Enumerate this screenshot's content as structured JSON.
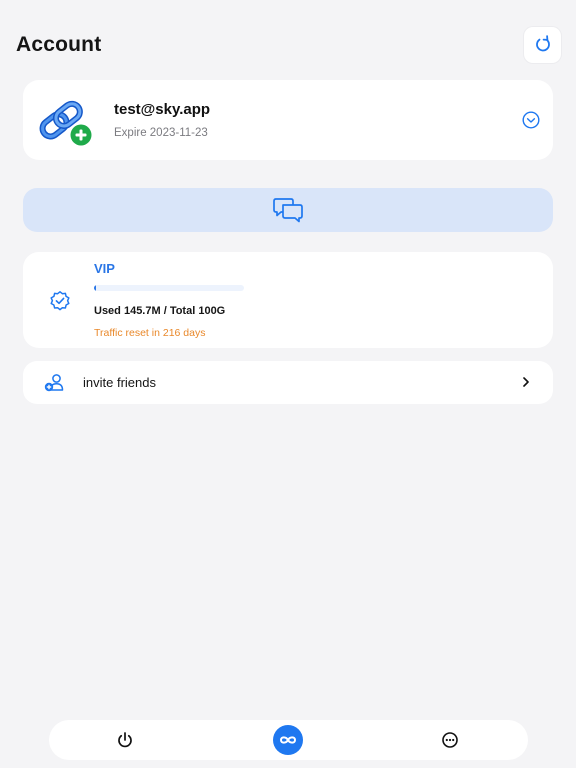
{
  "header": {
    "title": "Account",
    "refresh_icon": "refresh-icon"
  },
  "account": {
    "email": "test@sky.app",
    "expire": "Expire 2023-11-23",
    "logo_icon": "chain-link-add-icon",
    "expand_icon": "chevron-down-circle-icon"
  },
  "support": {
    "icon": "chat-bubbles-icon"
  },
  "plan": {
    "title": "VIP",
    "usage_text": "Used 145.7M / Total 100G",
    "usage_fraction": 0.0014,
    "reset_text": "Traffic reset in 216 days",
    "badge_icon": "verified-badge-icon"
  },
  "invite": {
    "label": "invite friends",
    "icon": "add-person-icon",
    "chevron_icon": "chevron-right-icon"
  },
  "tabbar": {
    "tabs": [
      {
        "name": "power",
        "icon": "power-icon",
        "active": false
      },
      {
        "name": "infinity",
        "icon": "infinity-icon",
        "active": true
      },
      {
        "name": "more",
        "icon": "more-dots-icon",
        "active": false
      }
    ]
  },
  "colors": {
    "accent": "#1f78f0",
    "vip_text": "#2a76e6",
    "reset_text": "#e9882a",
    "chat_bar": "#d9e5f9",
    "background": "#f4f4f6"
  }
}
